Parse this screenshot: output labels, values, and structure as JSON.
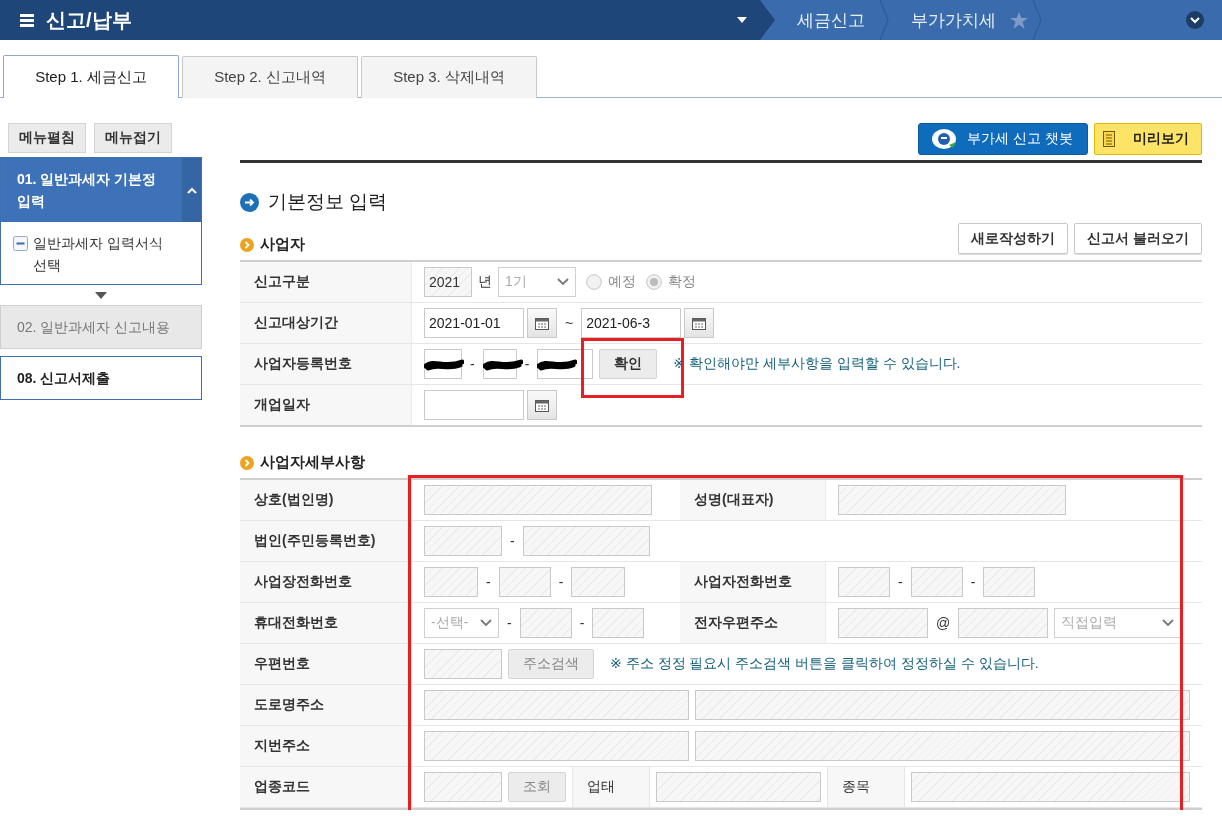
{
  "header": {
    "title": "신고/납부",
    "breadcrumbs": [
      "세금신고",
      "부가가치세"
    ]
  },
  "tabs": [
    {
      "label": "Step 1. 세금신고",
      "selected": true
    },
    {
      "label": "Step 2. 신고내역",
      "selected": false
    },
    {
      "label": "Step 3. 삭제내역",
      "selected": false
    }
  ],
  "sidebar": {
    "buttons": [
      "메뉴펼침",
      "메뉴접기"
    ],
    "items": [
      {
        "label": "01. 일반과세자 기본정 입력",
        "selected": true,
        "disabled": false,
        "expanded": true,
        "children": [
          {
            "label": "일반과세자 입력서식 선택"
          }
        ]
      },
      {
        "label": "02. 일반과세자 신고내용",
        "selected": false,
        "disabled": true,
        "expanded": false
      },
      {
        "label": "08. 신고서제출",
        "selected": false,
        "disabled": false,
        "expanded": false
      }
    ]
  },
  "toolbar": {
    "chatbot_button": "부가세 신고 챗봇",
    "preview_button": "미리보기"
  },
  "section_title": "기본정보 입력",
  "business": {
    "title": "사업자",
    "buttons": [
      "새로작성하기",
      "신고서 불러오기"
    ],
    "rows": [
      {
        "label": "신고구분",
        "controls": [
          {
            "kind": "input",
            "value": "2021",
            "disabled": true
          },
          {
            "kind": "unit",
            "text": "년"
          },
          {
            "kind": "select",
            "value": "1기",
            "disabled": true
          },
          {
            "kind": "radio",
            "text": "예정",
            "selected": false,
            "disabled": true
          },
          {
            "kind": "radio",
            "text": "확정",
            "selected": true,
            "disabled": true
          }
        ]
      },
      {
        "label": "신고대상기간",
        "controls": [
          {
            "kind": "date",
            "value": "2021-01-01",
            "disabled": false
          },
          {
            "kind": "sep",
            "text": "~"
          },
          {
            "kind": "date",
            "value": "2021-06-3",
            "disabled": false
          }
        ]
      },
      {
        "label": "사업자등록번호",
        "controls": [
          {
            "kind": "redacted"
          },
          {
            "kind": "sep",
            "text": "-"
          },
          {
            "kind": "redacted"
          },
          {
            "kind": "sep",
            "text": "-"
          },
          {
            "kind": "redacted"
          },
          {
            "kind": "button",
            "text": "확인",
            "disabled": false,
            "highlighted": true
          },
          {
            "kind": "note",
            "text": "※ 확인해야만 세부사항을 입력할 수 있습니다."
          }
        ]
      },
      {
        "label": "개업일자",
        "controls": [
          {
            "kind": "date",
            "disabled": false
          }
        ]
      }
    ]
  },
  "details": {
    "title": "사업자세부사항",
    "highlighted": true,
    "rows": [
      {
        "label": "상호(법인명)",
        "controls": [
          {
            "kind": "input",
            "disabled": true
          }
        ],
        "label2": "성명(대표자)",
        "controls2": [
          {
            "kind": "input",
            "disabled": true
          }
        ]
      },
      {
        "label": "법인(주민등록번호)",
        "controls": [
          {
            "kind": "input",
            "disabled": true
          },
          {
            "kind": "sep",
            "text": "-"
          },
          {
            "kind": "input",
            "disabled": true
          }
        ]
      },
      {
        "label": "사업장전화번호",
        "controls": [
          {
            "kind": "input",
            "disabled": true
          },
          {
            "kind": "sep",
            "text": "-"
          },
          {
            "kind": "input",
            "disabled": true
          },
          {
            "kind": "sep",
            "text": "-"
          },
          {
            "kind": "input",
            "disabled": true
          }
        ],
        "label2": "사업자전화번호",
        "controls2": [
          {
            "kind": "input",
            "disabled": true
          },
          {
            "kind": "sep",
            "text": "-"
          },
          {
            "kind": "input",
            "disabled": true
          },
          {
            "kind": "sep",
            "text": "-"
          },
          {
            "kind": "input",
            "disabled": true
          }
        ]
      },
      {
        "label": "휴대전화번호",
        "controls": [
          {
            "kind": "select",
            "value": "-선택-",
            "disabled": true
          },
          {
            "kind": "sep",
            "text": "-"
          },
          {
            "kind": "input",
            "disabled": true
          },
          {
            "kind": "sep",
            "text": "-"
          },
          {
            "kind": "input",
            "disabled": true
          }
        ],
        "label2": "전자우편주소",
        "controls2": [
          {
            "kind": "input",
            "disabled": true
          },
          {
            "kind": "sep",
            "text": "@"
          },
          {
            "kind": "input",
            "disabled": true
          },
          {
            "kind": "select",
            "value": "직접입력",
            "disabled": true
          }
        ]
      },
      {
        "label": "우편번호",
        "controls": [
          {
            "kind": "input",
            "disabled": true
          },
          {
            "kind": "button",
            "text": "주소검색",
            "disabled": true,
            "highlighted": false
          },
          {
            "kind": "note",
            "text": "※ 주소 정정 필요시 주소검색 버튼을 클릭하여 정정하실 수 있습니다."
          }
        ]
      },
      {
        "label": "도로명주소",
        "controls": [
          {
            "kind": "input",
            "disabled": true
          },
          {
            "kind": "input",
            "disabled": true
          }
        ]
      },
      {
        "label": "지번주소",
        "controls": [
          {
            "kind": "input",
            "disabled": true
          },
          {
            "kind": "input",
            "disabled": true
          }
        ]
      },
      {
        "label": "업종코드",
        "controls": [
          {
            "kind": "input",
            "disabled": true
          },
          {
            "kind": "button",
            "text": "조회",
            "disabled": true,
            "highlighted": false
          },
          {
            "kind": "cell-label",
            "text": "업태"
          },
          {
            "kind": "input",
            "disabled": true
          },
          {
            "kind": "cell-label",
            "text": "종목"
          },
          {
            "kind": "input",
            "disabled": true
          }
        ]
      }
    ]
  }
}
